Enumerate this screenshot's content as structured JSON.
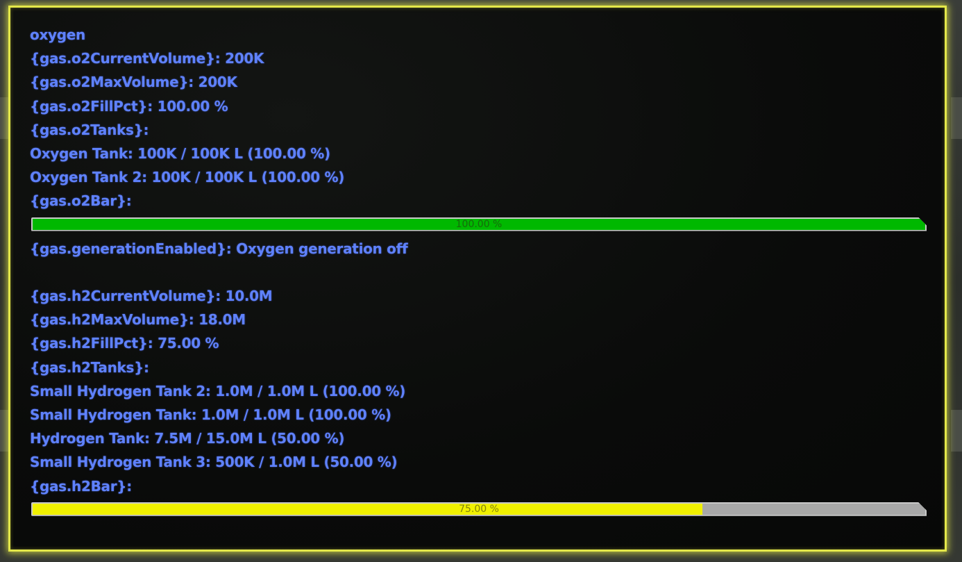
{
  "title": "oxygen",
  "oxygen": {
    "current_volume": "{gas.o2CurrentVolume}: 200K",
    "max_volume": "{gas.o2MaxVolume}: 200K",
    "fill_pct": "{gas.o2FillPct}: 100.00 %",
    "tanks_header": "{gas.o2Tanks}:",
    "tanks": [
      "Oxygen Tank: 100K / 100K L (100.00 %)",
      "Oxygen Tank 2: 100K / 100K L (100.00 %)"
    ],
    "bar_header": "{gas.o2Bar}:",
    "bar": {
      "label": "100.00 %",
      "fraction": 1.0,
      "color": "#00b800"
    },
    "generation": "{gas.generationEnabled}: Oxygen generation off"
  },
  "hydrogen": {
    "current_volume": "{gas.h2CurrentVolume}: 10.0M",
    "max_volume": "{gas.h2MaxVolume}: 18.0M",
    "fill_pct": "{gas.h2FillPct}: 75.00 %",
    "tanks_header": "{gas.h2Tanks}:",
    "tanks": [
      "Small Hydrogen Tank 2: 1.0M / 1.0M L (100.00 %)",
      "Small Hydrogen Tank: 1.0M / 1.0M L (100.00 %)",
      "Hydrogen Tank: 7.5M / 15.0M L (50.00 %)",
      "Small Hydrogen Tank 3: 500K / 1.0M L (50.00 %)"
    ],
    "bar_header": "{gas.h2Bar}:",
    "bar": {
      "label": "75.00 %",
      "fraction": 0.75,
      "color": "#f0f000"
    }
  },
  "colors": {
    "text": "#5f82ff",
    "frame": "#e4e84a",
    "bar_empty": "#a8a8a8"
  }
}
